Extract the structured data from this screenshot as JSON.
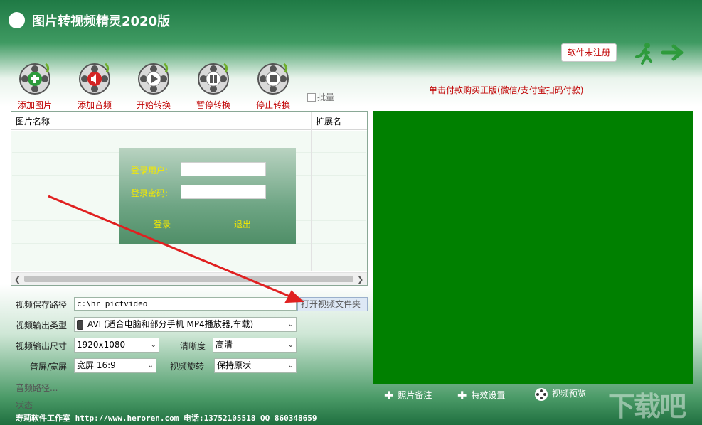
{
  "app": {
    "title": "图片转视频精灵2020版",
    "register_label": "软件未注册"
  },
  "toolbar": {
    "add_image": "添加图片",
    "add_audio": "添加音频",
    "start": "开始转换",
    "pause": "暂停转换",
    "stop": "停止转换",
    "batch": "批量"
  },
  "purchase_text": "单击付款购买正版(微信/支付宝扫码付款)",
  "image_list": {
    "columns": [
      "图片名称",
      "扩展名"
    ]
  },
  "login": {
    "user_label": "登录用户:",
    "password_label": "登录密码:",
    "user_value": "",
    "password_value": "",
    "login_button": "登录",
    "exit_button": "退出"
  },
  "form": {
    "save_path_label": "视频保存路径",
    "save_path_value": "c:\\hr_pictvideo",
    "open_folder_button": "打开视频文件夹",
    "output_type_label": "视频输出类型",
    "output_type_value": "AVI (适合电脑和部分手机 MP4播放器,车载)",
    "output_size_label": "视频输出尺寸",
    "output_size_value": "1920x1080",
    "clarity_label": "清晰度",
    "clarity_value": "高清",
    "screen_label": "普屏/宽屏",
    "screen_value": "宽屏 16:9",
    "rotate_label": "视频旋转",
    "rotate_value": "保持原状",
    "audio_path_label": "音频路径...",
    "status_label": "状态"
  },
  "preview": {
    "photo_note": "照片备注",
    "effects": "特效设置",
    "video_preview": "视频预览"
  },
  "footer": "寿莉软件工作室 http://www.heroren.com 电话:13752105518 QQ 860348659",
  "watermark": "下载吧",
  "colors": {
    "accent_red": "#c00000",
    "preview_green": "#008000",
    "login_yellow": "#f5e900"
  }
}
